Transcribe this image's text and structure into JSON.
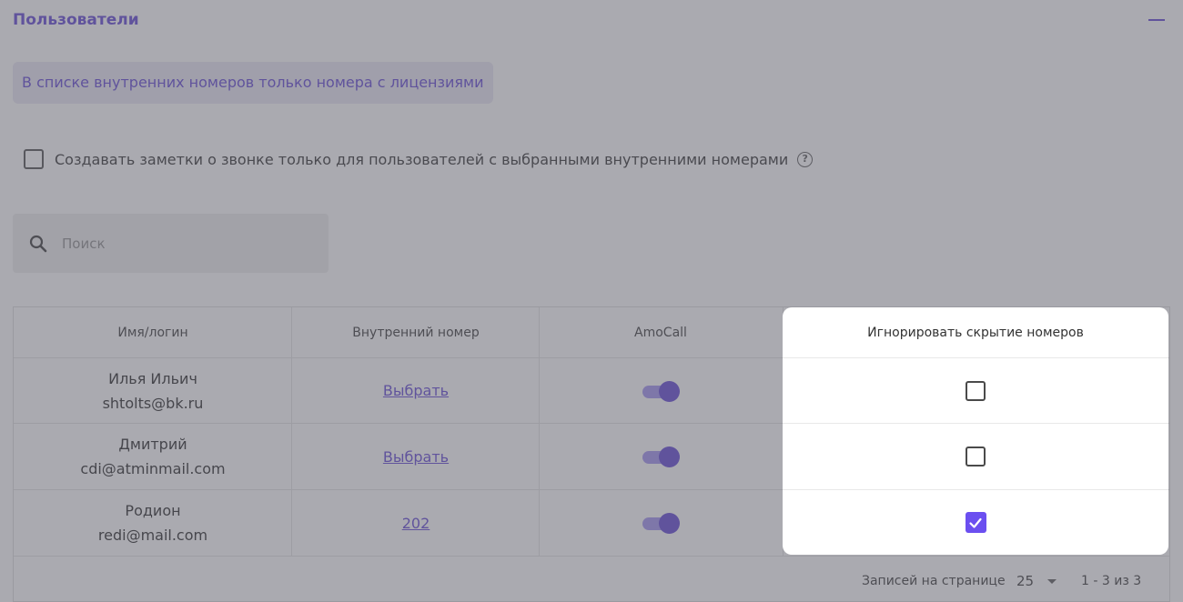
{
  "section": {
    "title": "Пользователи"
  },
  "info": {
    "text": "В списке внутренних номеров только номера с лицензиями"
  },
  "notes_option": {
    "label": "Создавать заметки о звонке только для пользователей с выбранными внутренними номерами",
    "checked": false
  },
  "search": {
    "placeholder": "Поиск",
    "value": ""
  },
  "table": {
    "headers": {
      "name": "Имя/логин",
      "extension": "Внутренний номер",
      "amocall": "AmoCall",
      "ignore_hiding": "Игнорировать скрытие номеров"
    },
    "rows": [
      {
        "name": "Илья Ильич",
        "login": "shtolts@bk.ru",
        "extension": "Выбрать",
        "amocall": true,
        "ignore_hiding": false
      },
      {
        "name": "Дмитрий",
        "login": "cdi@atminmail.com",
        "extension": "Выбрать",
        "amocall": true,
        "ignore_hiding": false
      },
      {
        "name": "Родион",
        "login": "redi@mail.com",
        "extension": "202",
        "amocall": true,
        "ignore_hiding": true
      }
    ]
  },
  "pagination": {
    "per_page_label": "Записей на странице",
    "per_page_value": "25",
    "range": "1 - 3 из 3"
  },
  "colors": {
    "accent": "#5b3fd3",
    "toggle_track": "#9d8ff0",
    "checkbox_checked": "#6b4ff0"
  }
}
